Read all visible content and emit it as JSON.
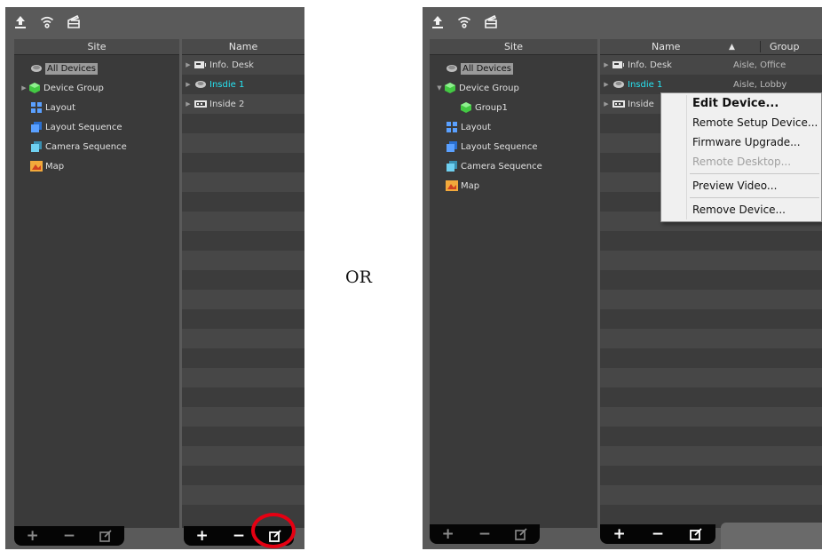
{
  "left": {
    "site_header": "Site",
    "name_header": "Name",
    "site_items": [
      {
        "label": "All Devices",
        "icon": "all-devices-icon"
      },
      {
        "label": "Device Group",
        "icon": "device-group-icon"
      },
      {
        "label": "Layout",
        "icon": "layout-icon"
      },
      {
        "label": "Layout Sequence",
        "icon": "layout-sequence-icon"
      },
      {
        "label": "Camera Sequence",
        "icon": "camera-sequence-icon"
      },
      {
        "label": "Map",
        "icon": "map-icon"
      }
    ],
    "devices": [
      {
        "name": "Info. Desk"
      },
      {
        "name": "Insdie 1"
      },
      {
        "name": "Inside 2"
      }
    ],
    "bottom_buttons": [
      "+",
      "−",
      "☑"
    ]
  },
  "separator_text": "OR",
  "right": {
    "site_header": "Site",
    "name_header": "Name",
    "sort_indicator": "▲",
    "group_header": "Group",
    "site_items": [
      {
        "label": "All Devices",
        "icon": "all-devices-icon"
      },
      {
        "label": "Device Group",
        "icon": "device-group-icon"
      },
      {
        "label": "Group1",
        "icon": "group-icon"
      },
      {
        "label": "Layout",
        "icon": "layout-icon"
      },
      {
        "label": "Layout Sequence",
        "icon": "layout-sequence-icon"
      },
      {
        "label": "Camera Sequence",
        "icon": "camera-sequence-icon"
      },
      {
        "label": "Map",
        "icon": "map-icon"
      }
    ],
    "devices": [
      {
        "name": "Info. Desk",
        "group": "Aisle, Office"
      },
      {
        "name": "Insdie 1",
        "group": "Aisle, Lobby"
      },
      {
        "name": "Inside",
        "group": ""
      }
    ],
    "context_menu": [
      "Edit Device...",
      "Remote Setup Device...",
      "Firmware Upgrade...",
      "Remote Desktop...",
      "Preview Video...",
      "Remove Device..."
    ]
  },
  "colors": {
    "panel_bg": "#5a5a5a",
    "highlight_text": "#27e4f2",
    "annotation_red": "#e60012"
  }
}
